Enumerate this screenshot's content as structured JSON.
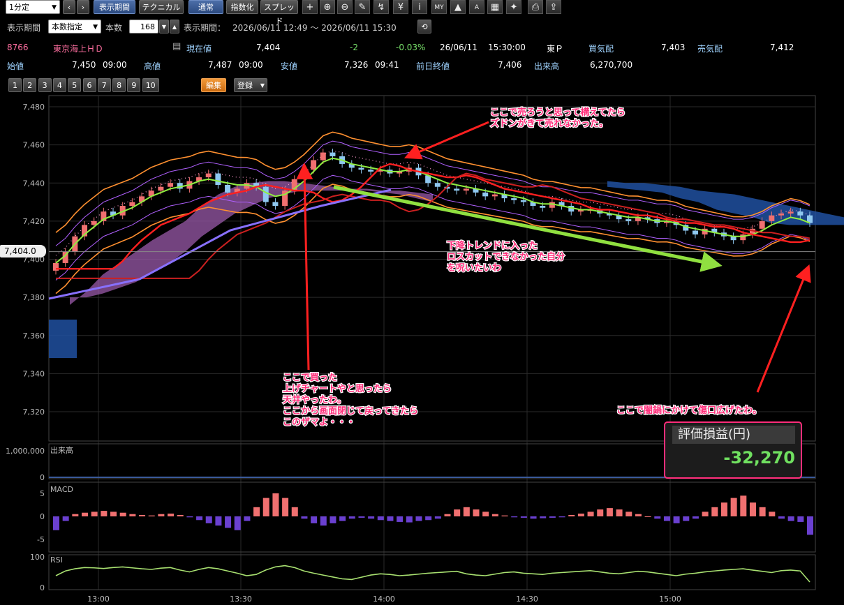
{
  "toolbar": {
    "interval": "1分定",
    "buttons": [
      "表示期間",
      "テクニカル",
      "通常",
      "指数化",
      "スプレッド"
    ],
    "icons": [
      "crosshair-icon",
      "zoom-in-icon",
      "zoom-out-icon",
      "pencil-icon",
      "trendline-icon",
      "yen-icon",
      "info-icon",
      "my-icon",
      "area-icon",
      "auto-icon",
      "chart-icon",
      "wrench-icon",
      "print-icon",
      "export-icon"
    ]
  },
  "period_row": {
    "label": "表示期間",
    "mode": "本数指定",
    "count_label": "本数",
    "count": "168",
    "range_label": "表示期間：",
    "range": "2026/06/11 12:49 〜 2026/06/11 15:30"
  },
  "quote": {
    "code": "8766",
    "name": "東京海上ＨＤ",
    "current_label": "現在値",
    "current": "7,404",
    "change": "-2",
    "change_pct": "-0.03%",
    "date": "26/06/11",
    "time": "15:30:00",
    "market": "東Ｐ",
    "bid_label": "買気配",
    "bid": "7,403",
    "ask_label": "売気配",
    "ask": "7,412",
    "open_label": "始値",
    "open": "7,450",
    "open_time": "09:00",
    "high_label": "高値",
    "high": "7,487",
    "high_time": "09:00",
    "low_label": "安値",
    "low": "7,326",
    "low_time": "09:41",
    "prev_label": "前日終値",
    "prev": "7,406",
    "volume_label": "出来高",
    "volume": "6,270,700"
  },
  "tabs": [
    "1",
    "2",
    "3",
    "4",
    "5",
    "6",
    "7",
    "8",
    "9",
    "10"
  ],
  "edit_label": "編集",
  "register_label": "登録",
  "panels": {
    "volume_label": "出来高",
    "volume_tick": "1,000,000",
    "volume_zero": "0",
    "macd_label": "MACD",
    "macd_ticks": [
      "5",
      "0",
      "-5"
    ],
    "rsi_label": "RSI",
    "rsi_ticks": [
      "100",
      "0"
    ]
  },
  "price_marker": "7,404.0",
  "annotations": {
    "sell": [
      "ここで売ろうと思って構えてたら",
      "ズドンがきて売れなかった。"
    ],
    "trend": [
      "下降トレンドに入った",
      "ロスカットできなかった自分",
      "を呪いたいわ"
    ],
    "buy": [
      "ここで買った",
      "上げチャートやと思ったら",
      "天井やったわ。",
      "ここから画面閉じて戻ってきたら",
      "このザマよ・・・"
    ],
    "average_down": "ここで闇鍋にかけて傷口広げたわ。"
  },
  "pl": {
    "title": "評価損益(円)",
    "value": "-32,270"
  },
  "colors": {
    "up": "#f07070",
    "down": "#8fc8f0",
    "sma_fast": "#90ee40",
    "sma_mid": "#ff2020",
    "band": "#ff9030",
    "cloud_pos": "#9a5aaa",
    "cloud_neg": "#2050a0",
    "annotation": "#ff2d7a"
  },
  "chart_data": {
    "type": "candlestick",
    "x_ticks": [
      "13:00",
      "13:30",
      "14:00",
      "14:30",
      "15:00"
    ],
    "y_ticks": [
      7480,
      7460,
      7440,
      7420,
      7400,
      7380,
      7360,
      7340,
      7320
    ],
    "ylim": [
      7310,
      7485
    ],
    "close": [
      7398,
      7404,
      7412,
      7418,
      7420,
      7425,
      7423,
      7428,
      7430,
      7433,
      7436,
      7438,
      7440,
      7437,
      7441,
      7443,
      7445,
      7439,
      7435,
      7437,
      7440,
      7438,
      7430,
      7428,
      7436,
      7442,
      7447,
      7452,
      7456,
      7454,
      7450,
      7448,
      7447,
      7446,
      7447,
      7445,
      7446,
      7448,
      7444,
      7440,
      7438,
      7437,
      7436,
      7437,
      7435,
      7433,
      7434,
      7432,
      7431,
      7430,
      7428,
      7427,
      7430,
      7428,
      7425,
      7426,
      7426,
      7424,
      7423,
      7421,
      7420,
      7422,
      7421,
      7419,
      7420,
      7418,
      7415,
      7413,
      7416,
      7414,
      7412,
      7410,
      7413,
      7416,
      7420,
      7423,
      7424,
      7425,
      7423,
      7419
    ],
    "sma_fast": [
      7398,
      7402,
      7408,
      7413,
      7417,
      7421,
      7423,
      7425,
      7427,
      7430,
      7433,
      7435,
      7437,
      7438,
      7439,
      7441,
      7442,
      7441,
      7440,
      7439,
      7439,
      7438,
      7435,
      7433,
      7434,
      7437,
      7441,
      7446,
      7451,
      7453,
      7452,
      7450,
      7449,
      7448,
      7447,
      7446,
      7446,
      7447,
      7446,
      7444,
      7442,
      7440,
      7439,
      7438,
      7437,
      7436,
      7435,
      7434,
      7433,
      7432,
      7430,
      7429,
      7429,
      7428,
      7427,
      7426,
      7426,
      7425,
      7424,
      7423,
      7422,
      7422,
      7421,
      7420,
      7420,
      7419,
      7417,
      7416,
      7415,
      7414,
      7413,
      7412,
      7412,
      7413,
      7415,
      7418,
      7420,
      7422,
      7421,
      7419
    ],
    "macd": [
      -3,
      -1,
      0.5,
      0.8,
      1,
      1.2,
      1,
      0.8,
      0.5,
      0.3,
      0.2,
      0.5,
      0.6,
      0.3,
      -0.2,
      -0.8,
      -1.5,
      -2,
      -2.5,
      -3,
      -1,
      2,
      4,
      5,
      4,
      2,
      -0.5,
      -1.5,
      -2,
      -1.5,
      -1,
      -0.5,
      -0.3,
      -0.5,
      -0.8,
      -1,
      -1.2,
      -1.3,
      -1,
      -0.8,
      -0.5,
      0.5,
      1.5,
      2,
      1.5,
      1,
      0.5,
      0.2,
      -0.2,
      -0.3,
      -0.5,
      -0.4,
      -0.3,
      -0.2,
      0.3,
      0.6,
      1,
      1.5,
      1.8,
      1.5,
      1,
      0.5,
      0,
      -0.5,
      -1,
      -1.5,
      -1,
      -0.5,
      1,
      2,
      3,
      4,
      4.5,
      3,
      2,
      1,
      -0.5,
      -1,
      -1.2,
      -4
    ],
    "rsi": [
      40,
      55,
      62,
      66,
      65,
      63,
      66,
      68,
      65,
      62,
      60,
      64,
      66,
      58,
      52,
      60,
      66,
      62,
      55,
      48,
      40,
      44,
      58,
      68,
      72,
      66,
      55,
      48,
      42,
      36,
      30,
      28,
      35,
      42,
      46,
      44,
      40,
      42,
      45,
      48,
      50,
      52,
      54,
      46,
      42,
      40,
      45,
      50,
      52,
      48,
      46,
      44,
      48,
      50,
      52,
      54,
      56,
      52,
      48,
      46,
      50,
      54,
      52,
      48,
      44,
      40,
      45,
      48,
      52,
      55,
      58,
      60,
      62,
      58,
      54,
      50,
      56,
      58,
      55,
      20
    ]
  }
}
